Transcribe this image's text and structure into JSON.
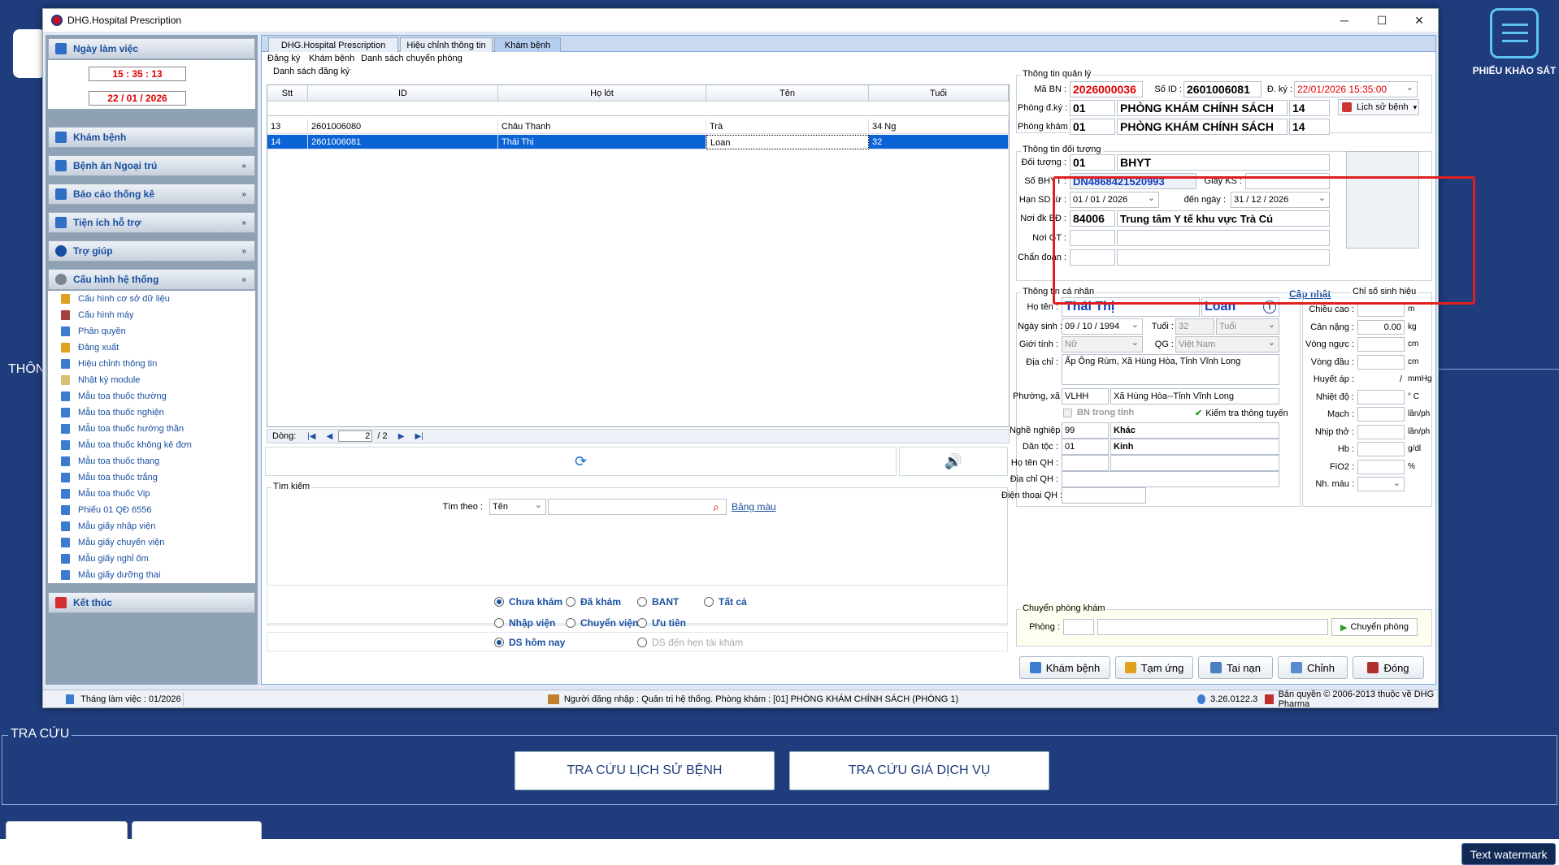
{
  "background": {
    "left_text": "THÔN",
    "survey_label": "PHIẾU KHẢO SÁT",
    "tracuu_title": "TRA CỨU",
    "btn_history": "TRA CỨU LỊCH SỬ BỆNH",
    "btn_price": "TRA CỨU GIÁ DỊCH VỤ",
    "watermark": "Text watermark"
  },
  "window": {
    "title": "DHG.Hospital Prescription",
    "minimize": "─",
    "maximize": "☐",
    "close": "✕"
  },
  "sidebar": {
    "work_day": "Ngày làm việc",
    "time": "15 : 35 : 13",
    "date": "22 / 01 / 2026",
    "sections": [
      "Khám bệnh",
      "Bệnh án Ngoại trú",
      "Báo cáo thống kê",
      "Tiện ích hỗ trợ",
      "Trợ giúp",
      "Cấu hình hệ thống"
    ],
    "chev_down": "»",
    "chev_up": "«",
    "items": [
      "Cấu hình cơ sở dữ liệu",
      "Cấu hình máy",
      "Phân quyền",
      "Đăng xuất",
      "Hiệu chỉnh thông tin",
      "Nhật ký module",
      "Mẫu toa thuốc thường",
      "Mẫu toa thuốc nghiện",
      "Mẫu toa thuốc hướng thần",
      "Mẫu toa thuốc không kê đơn",
      "Mẫu toa thuốc thang",
      "Mẫu toa thuốc trắng",
      "Mẫu toa thuốc Vip",
      "Phiếu 01 QĐ 6556",
      "Mẫu giấy nhập viện",
      "Mẫu giấy chuyển viện",
      "Mẫu giấy nghỉ ốm",
      "Mẫu giấy dưỡng thai"
    ],
    "exit": "Kết thúc"
  },
  "tabs": [
    "DHG.Hospital Prescription",
    "Hiệu chỉnh thông tin",
    "Khám bệnh"
  ],
  "subtabs": [
    "Đăng ký",
    "Khám bệnh",
    "Danh sách chuyển phòng"
  ],
  "list": {
    "title": "Danh sách đăng ký",
    "headers": [
      "Stt",
      "ID",
      "Họ lót",
      "Tên",
      "Tuổi"
    ],
    "rows": [
      [
        "13",
        "2601006080",
        "Châu Thanh",
        "Trà",
        "34 Ng"
      ],
      [
        "14",
        "2601006081",
        "Thái Thị",
        "Loan",
        "32"
      ]
    ],
    "pager_label": "Dòng:",
    "page_current": "2",
    "page_total": "/   2"
  },
  "search": {
    "title": "Tìm kiếm",
    "by_label": "Tìm theo :",
    "by_value": "Tên",
    "color_link": "Bảng màu",
    "radios": [
      "Chưa khám",
      "Đã khám",
      "BANT",
      "Tất cả",
      "Nhập viện",
      "Chuyển viện",
      "Ưu tiên",
      "DS hôm nay",
      "DS đến hẹn tái khám"
    ]
  },
  "admin": {
    "title": "Thông tin quản lý",
    "ma_bn_label": "Mã BN :",
    "ma_bn": "2026000036",
    "so_id_label": "Số ID :",
    "so_id": "2601006081",
    "dky_label": "Đ. ký :",
    "dky": "22/01/2026 15:35:00",
    "phong_dk_label": "Phòng đ.ký :",
    "phong_dk_code": "01",
    "phong_dk_name": "PHÒNG KHÁM CHÍNH SÁCH",
    "phong_dk_no": "14",
    "history_btn": "Lịch sử bệnh",
    "phong_kham_label": "Phòng khám :",
    "phong_kham_code": "01",
    "phong_kham_name": "PHÒNG KHÁM CHÍNH SÁCH",
    "phong_kham_no": "14"
  },
  "insurance": {
    "title": "Thông tin đối tượng",
    "doi_tuong_label": "Đối tượng :",
    "doi_tuong_code": "01",
    "doi_tuong": "BHYT",
    "so_bhyt_label": "Số BHYT :",
    "so_bhyt": "DN4868421520993",
    "giay_ks_label": "Giấy KS :",
    "han_sd_label": "Hạn SD từ :",
    "han_sd_from": "01 / 01 / 2026",
    "den_ngay_label": "đến ngày :",
    "han_sd_to": "31 / 12 / 2026",
    "noi_dk_label": "Nơi đk BĐ :",
    "noi_dk_code": "84006",
    "noi_dk_name": "Trung tâm Y tế khu vực Trà Cú",
    "noi_gt_label": "Nơi GT :",
    "chan_doan_label": "Chẩn đoán :"
  },
  "personal": {
    "title": "Thông tin cá nhân",
    "update_link": "Cập nhật",
    "ho_ten_label": "Họ tên :",
    "ho_lot": "Thái Thị",
    "ten": "Loan",
    "ngay_sinh_label": "Ngày sinh :",
    "ngay_sinh": "09 / 10 / 1994",
    "tuoi_label": "Tuổi :",
    "tuoi": "32",
    "tuoi_unit": "Tuổi",
    "gioi_tinh_label": "Giới tính :",
    "gioi_tinh": "Nữ",
    "qg_label": "QG :",
    "qg": "Việt Nam",
    "dia_chi_label": "Địa chỉ :",
    "dia_chi": "Ấp Ông Rùm, Xã Hùng Hòa, Tỉnh Vĩnh Long",
    "phuong_xa_label": "Phường, xã :",
    "phuong_xa_code": "VLHH",
    "phuong_xa": "Xã Hùng Hòa--Tỉnh Vĩnh Long",
    "bn_trong_tinh": "BN trong tỉnh",
    "kiem_tra": "Kiểm tra thông tuyến",
    "nghe_nghiep_label": "Nghề nghiệp :",
    "nghe_nghiep_code": "99",
    "nghe_nghiep": "Khác",
    "dan_toc_label": "Dân tộc :",
    "dan_toc_code": "01",
    "dan_toc": "Kinh",
    "ho_ten_qh_label": "Họ tên QH :",
    "dia_chi_qh_label": "Địa chỉ QH :",
    "dien_thoai_qh_label": "Điện thoại QH :"
  },
  "vitals": {
    "title": "Chỉ số sinh hiệu",
    "items": [
      {
        "label": "Chiều cao :",
        "value": "",
        "unit": "m"
      },
      {
        "label": "Cân nặng :",
        "value": "0.00",
        "unit": "kg"
      },
      {
        "label": "Vòng ngực :",
        "value": "",
        "unit": "cm"
      },
      {
        "label": "Vòng đầu :",
        "value": "",
        "unit": "cm"
      },
      {
        "label": "Huyết áp :",
        "value": "/",
        "unit": "mmHg"
      },
      {
        "label": "Nhiệt độ :",
        "value": "",
        "unit": "° C"
      },
      {
        "label": "Mạch :",
        "value": "",
        "unit": "lần/ph"
      },
      {
        "label": "Nhịp thở :",
        "value": "",
        "unit": "lần/ph"
      },
      {
        "label": "Hb :",
        "value": "",
        "unit": "g/dl"
      },
      {
        "label": "FiO2 :",
        "value": "",
        "unit": "%"
      },
      {
        "label": "Nh. máu :",
        "value": "",
        "unit": ""
      }
    ]
  },
  "transfer": {
    "title": "Chuyển phòng khám",
    "phong_label": "Phòng :",
    "btn": "Chuyển phòng"
  },
  "actions": [
    "Khám bệnh",
    "Tạm ứng",
    "Tai nạn",
    "Chỉnh",
    "Đóng"
  ],
  "status": {
    "month": "Tháng làm việc : 01/2026",
    "login": "Người đăng nhập : Quản trị hệ thống. Phòng khám : [01] PHÒNG KHÁM CHÍNH SÁCH (PHÒNG 1)",
    "version": "3.26.0122.3",
    "copyright": "Bản quyền © 2006-2013 thuộc về DHG Pharma"
  },
  "colors": {
    "accent": "#1a4fa0",
    "highlight": "#e02020",
    "selected_row": "#0a64d6",
    "background": "#1f3c7d"
  }
}
